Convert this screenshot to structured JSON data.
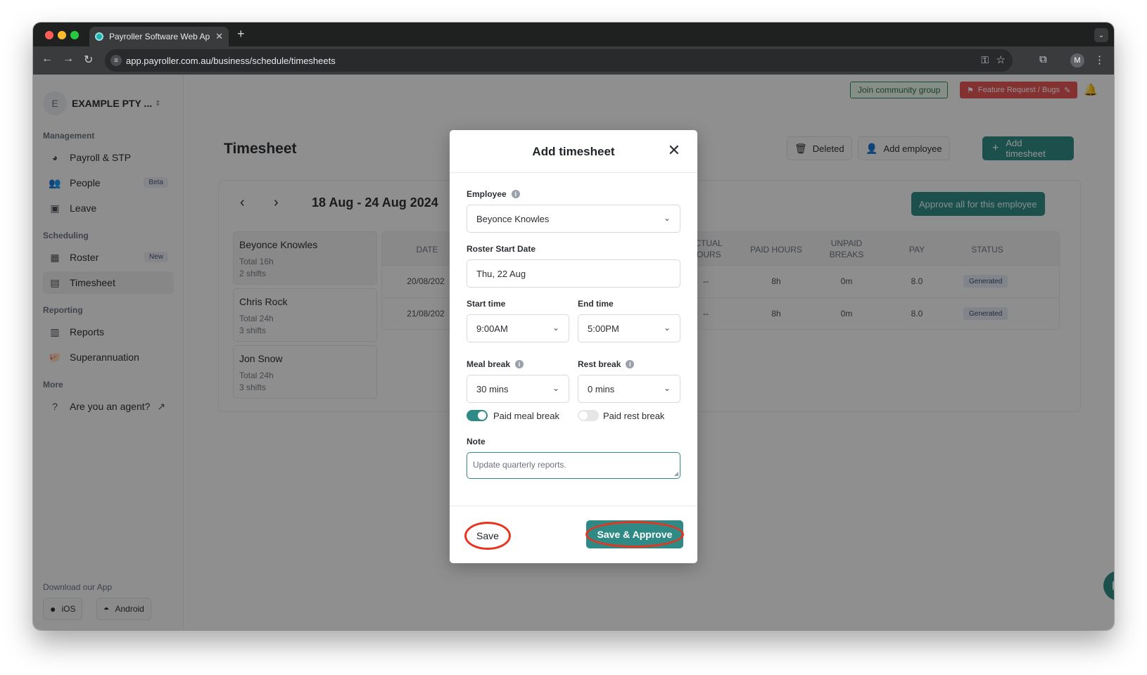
{
  "browser": {
    "tab_title": "Payroller Software Web Appli",
    "url": "app.payroller.com.au/business/schedule/timesheets",
    "profile_initial": "M"
  },
  "sidebar": {
    "org_initial": "E",
    "org_name": "EXAMPLE PTY ...",
    "sections": {
      "management": "Management",
      "scheduling": "Scheduling",
      "reporting": "Reporting",
      "more": "More"
    },
    "items": {
      "payroll": "Payroll & STP",
      "people": "People",
      "people_badge": "Beta",
      "leave": "Leave",
      "roster": "Roster",
      "roster_badge": "New",
      "timesheet": "Timesheet",
      "reports": "Reports",
      "superannuation": "Superannuation",
      "agent": "Are you an agent?"
    },
    "download_label": "Download our App",
    "ios": "iOS",
    "android": "Android"
  },
  "topbar": {
    "community": "Join community group",
    "feature": "Feature Request / Bugs"
  },
  "page": {
    "title": "Timesheet",
    "deleted": "Deleted",
    "add_employee": "Add employee",
    "add_timesheet": "Add timesheet",
    "week": "18 Aug - 24 Aug 2024",
    "approve_all": "Approve all for this employee"
  },
  "employees": [
    {
      "name": "Beyonce Knowles",
      "total": "Total 16h",
      "shifts": "2 shifts"
    },
    {
      "name": "Chris Rock",
      "total": "Total 24h",
      "shifts": "3 shifts"
    },
    {
      "name": "Jon Snow",
      "total": "Total 24h",
      "shifts": "3 shifts"
    }
  ],
  "table": {
    "headers": {
      "date": "DATE",
      "actual_1": "ACTUAL",
      "actual_2": "HOURS",
      "paid": "PAID HOURS",
      "unpaid_1": "UNPAID",
      "unpaid_2": "BREAKS",
      "pay": "PAY",
      "status": "STATUS"
    },
    "rows": [
      {
        "date": "20/08/202",
        "actual": "--",
        "paid": "8h",
        "unpaid": "0m",
        "pay": "8.0",
        "status": "Generated"
      },
      {
        "date": "21/08/202",
        "actual": "--",
        "paid": "8h",
        "unpaid": "0m",
        "pay": "8.0",
        "status": "Generated"
      }
    ]
  },
  "modal": {
    "title": "Add timesheet",
    "employee_label": "Employee",
    "employee_value": "Beyonce Knowles",
    "roster_label": "Roster Start Date",
    "roster_value": "Thu, 22 Aug",
    "start_label": "Start time",
    "start_value": "9:00AM",
    "end_label": "End time",
    "end_value": "5:00PM",
    "meal_label": "Meal break",
    "meal_value": "30 mins",
    "rest_label": "Rest break",
    "rest_value": "0 mins",
    "paid_meal_label": "Paid meal break",
    "paid_meal_on": true,
    "paid_rest_label": "Paid rest break",
    "paid_rest_on": false,
    "note_label": "Note",
    "note_value": "Update quarterly reports.",
    "save": "Save",
    "save_approve": "Save & Approve"
  }
}
